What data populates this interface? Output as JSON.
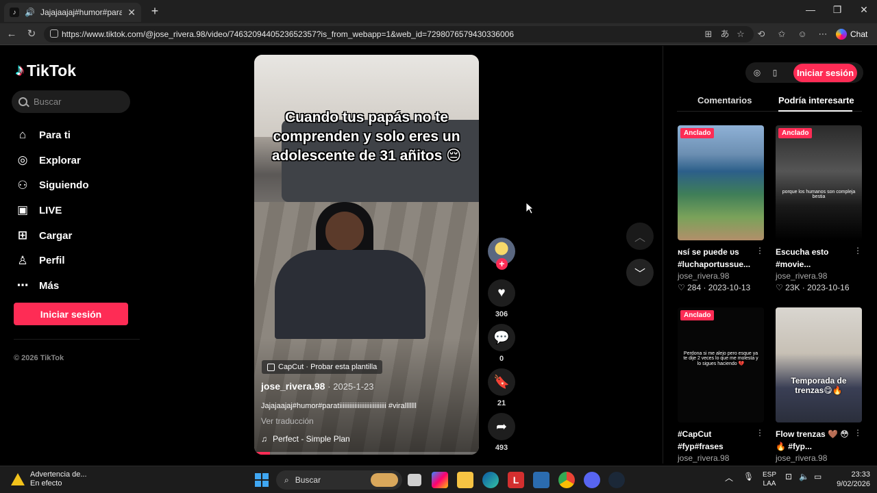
{
  "browser": {
    "tab_title": "Jajajaajaj#humor#paratiiiiiiiiiiiii",
    "url": "https://www.tiktok.com/@jose_rivera.98/video/7463209440523652357?is_from_webapp=1&web_id=7298076579430336006",
    "chat_label": "Chat"
  },
  "sidebar": {
    "logo_text": "TikTok",
    "search_placeholder": "Buscar",
    "nav": [
      {
        "label": "Para ti",
        "icon": "home-icon"
      },
      {
        "label": "Explorar",
        "icon": "compass-icon"
      },
      {
        "label": "Siguiendo",
        "icon": "following-icon"
      },
      {
        "label": "LIVE",
        "icon": "live-icon"
      },
      {
        "label": "Cargar",
        "icon": "upload-icon"
      },
      {
        "label": "Perfil",
        "icon": "profile-icon"
      },
      {
        "label": "Más",
        "icon": "more-icon"
      }
    ],
    "login_label": "Iniciar sesión",
    "copyright": "© 2026 TikTok"
  },
  "video": {
    "caption_overlay": "Cuando tus papás no te comprenden y solo eres un adolescente de 31 añitos 😔",
    "capcut_label": "CapCut · Probar esta plantilla",
    "author": "jose_rivera.98",
    "date": "2025-1-23",
    "description": "Jajajaajaj#humor#paratiiiiiiiiiiiiiiiiiiiiiiiiiiii #viralllllll",
    "translate_label": "Ver traducción",
    "music": "Perfect - Simple Plan",
    "progress": 0.07
  },
  "actions": {
    "likes": "306",
    "comments": "0",
    "saves": "21",
    "shares": "493"
  },
  "right_panel": {
    "login_label": "Iniciar sesión",
    "tabs": [
      "Comentarios",
      "Podría interesarte"
    ],
    "active_tab": "Podría interesarte",
    "pinned_label": "Anclado",
    "cards": [
      {
        "title": "ɴsí se puede ᴜs #luchaportussue...",
        "author": "jose_rivera.98",
        "stats": "♡ 284 · 2023-10-13",
        "pinned": true,
        "thumb_text": ""
      },
      {
        "title": "Escucha esto #movie...",
        "author": "jose_rivera.98",
        "stats": "♡ 23K · 2023-10-16",
        "pinned": true,
        "thumb_text": "porque los humanos son compleja bestia"
      },
      {
        "title": "#CapCut #fyp#frases",
        "author": "jose_rivera.98",
        "stats": "",
        "pinned": true,
        "thumb_text": "Perdona si me alejo pero esque ya te dije 2 veces lo que me molesta y lo sigues haciendo 💔"
      },
      {
        "title": "Flow trenzas 🤎 😳 🔥 #fyp...",
        "author": "jose_rivera.98",
        "stats": "",
        "pinned": false,
        "thumb_text": "Temporada de trenzas😋🔥"
      }
    ]
  },
  "taskbar": {
    "notification_title": "Advertencia de...",
    "notification_sub": "En efecto",
    "search_label": "Buscar",
    "lang_top": "ESP",
    "lang_bottom": "LAA",
    "time": "23:33",
    "date": "9/02/2026"
  }
}
